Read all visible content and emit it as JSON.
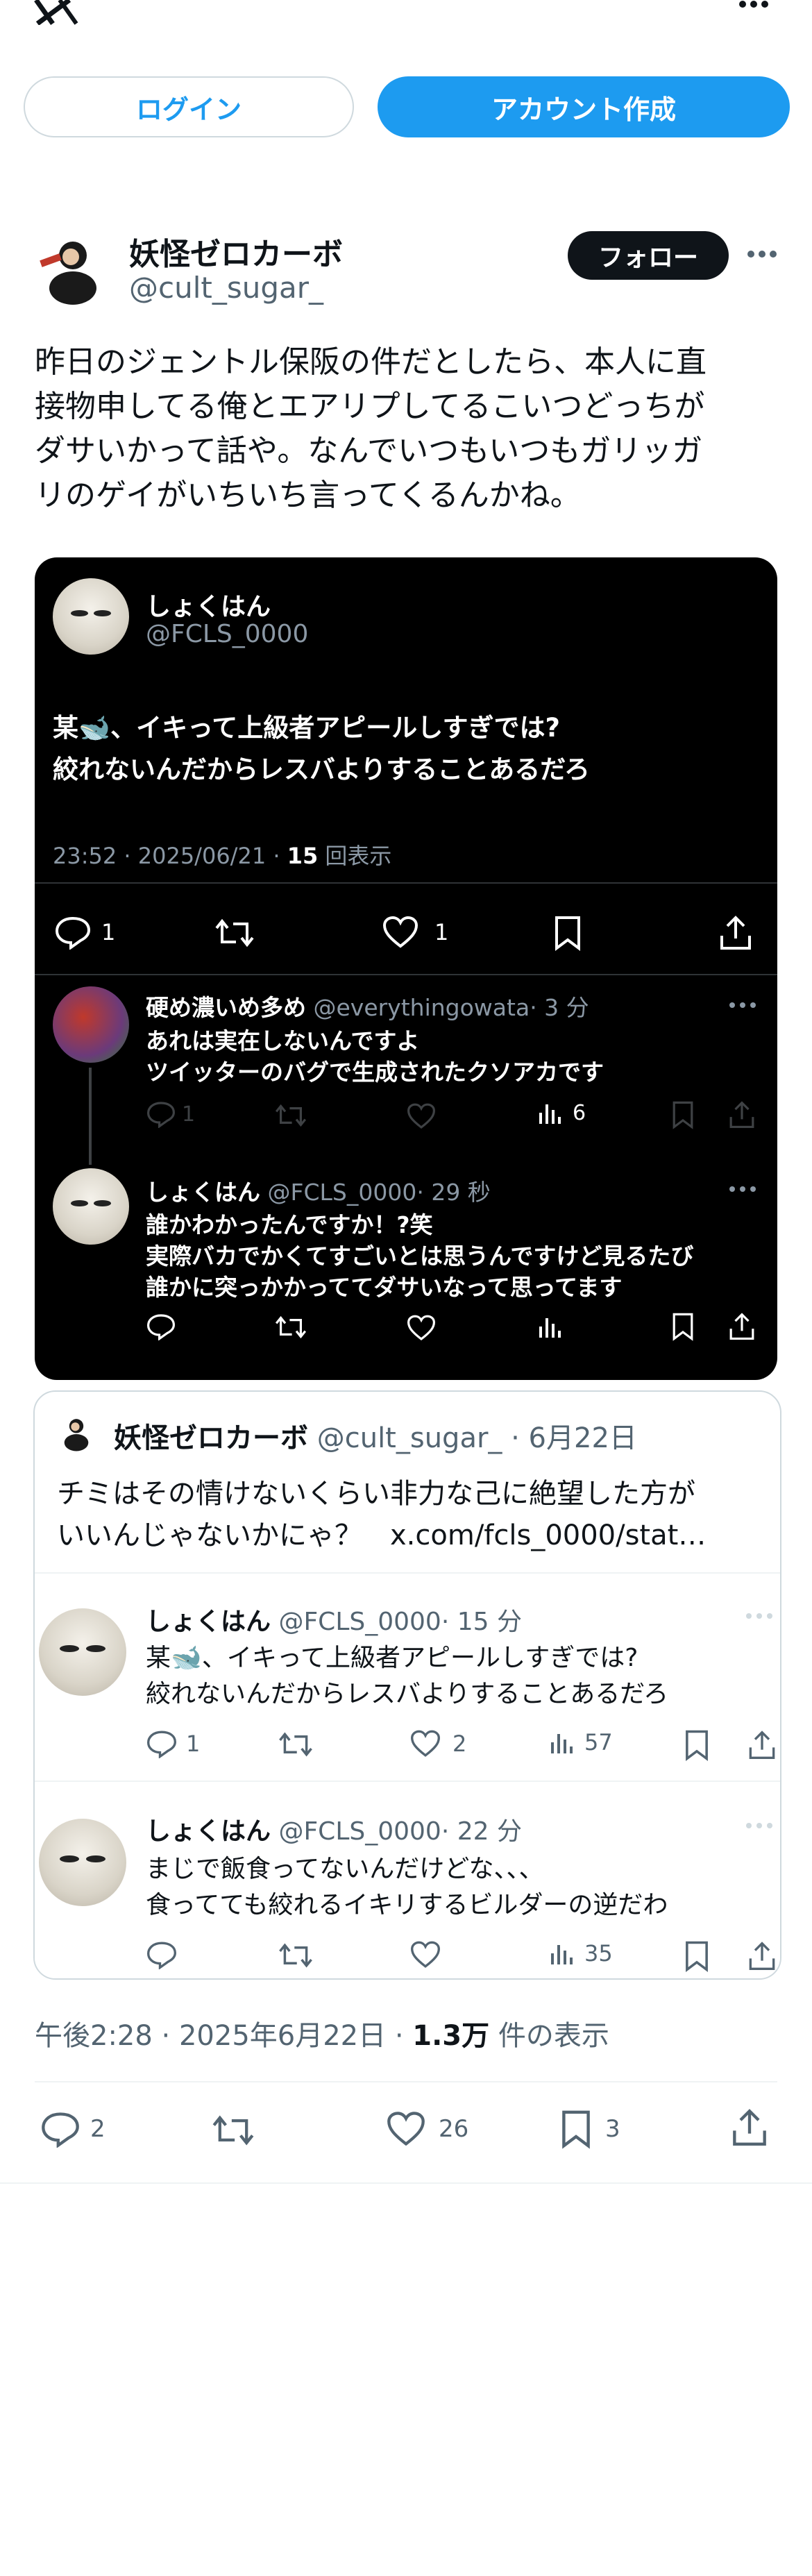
{
  "header": {
    "logo": "x-logo-icon",
    "more": "more-icon"
  },
  "auth": {
    "login_label": "ログイン",
    "signup_label": "アカウント作成"
  },
  "post": {
    "author_name": "妖怪ゼロカーボ",
    "author_handle": "@cult_sugar_",
    "follow_label": "フォロー",
    "text_lines": [
      "昨日のジェントル保阪の件だとしたら、本人に直",
      "接物申してる俺とエアリプしてるこいつどっちが",
      "ダサいかって話や。なんでいつもいつもガリッガ",
      "リのゲイがいちいち言ってくるんかね。"
    ],
    "timestamp": "午後2:28 · 2025年6月22日 · ",
    "views_count": "1.3万",
    "views_label": " 件の表示",
    "actions": {
      "replies": "2",
      "likes": "26",
      "bookmarks": "3"
    }
  },
  "screenshot_card": {
    "main": {
      "name": "しょくはん",
      "handle": "@FCLS_0000",
      "line1": "某🐋、イキって上級者アピールしすぎでは?",
      "line2": "絞れないんだからレスバよりすることあるだろ",
      "meta_prefix": "23:52 · 2025/06/21 · ",
      "meta_views": "15",
      "meta_suffix": " 回表示",
      "replies": "1",
      "likes": "1"
    },
    "reply1": {
      "name": "硬め濃いめ多め",
      "handle": "@everythingowata",
      "time": "· 3 分",
      "line1": "あれは実在しないんですよ",
      "line2": "ツイッターのバグで生成されたクソアカです",
      "replies": "1",
      "views": "6"
    },
    "reply2": {
      "name": "しょくはん",
      "handle": "@FCLS_0000",
      "time": "· 29 秒",
      "line1": "誰かわかったんですか！?笑",
      "line2": "実際バカでかくてすごいとは思うんですけど見るたび",
      "line3": "誰かに突っかかっててダサいなって思ってます"
    }
  },
  "quote_card": {
    "name": "妖怪ゼロカーボ",
    "handle": "@cult_sugar_",
    "date": "· 6月22日",
    "line1": "チミはその情けないくらい非力な己に絶望した方が",
    "line2": "いいんじゃないかにゃ？　x.com/fcls_0000/stat…",
    "reply1": {
      "name": "しょくはん",
      "handle": "@FCLS_0000",
      "time": "· 15 分",
      "line1": "某🐋、イキって上級者アピールしすぎでは?",
      "line2": "絞れないんだからレスバよりすることあるだろ",
      "replies": "1",
      "likes": "2",
      "views": "57"
    },
    "reply2": {
      "name": "しょくはん",
      "handle": "@FCLS_0000",
      "time": "· 22 分",
      "line1": "まじで飯食ってないんだけどな、、、",
      "line2": "食ってても絞れるイキリするビルダーの逆だわ",
      "views": "35"
    }
  },
  "colors": {
    "accent": "#1d9bf0",
    "text": "#0f1419",
    "muted": "#536471",
    "border": "#eff3f4"
  }
}
